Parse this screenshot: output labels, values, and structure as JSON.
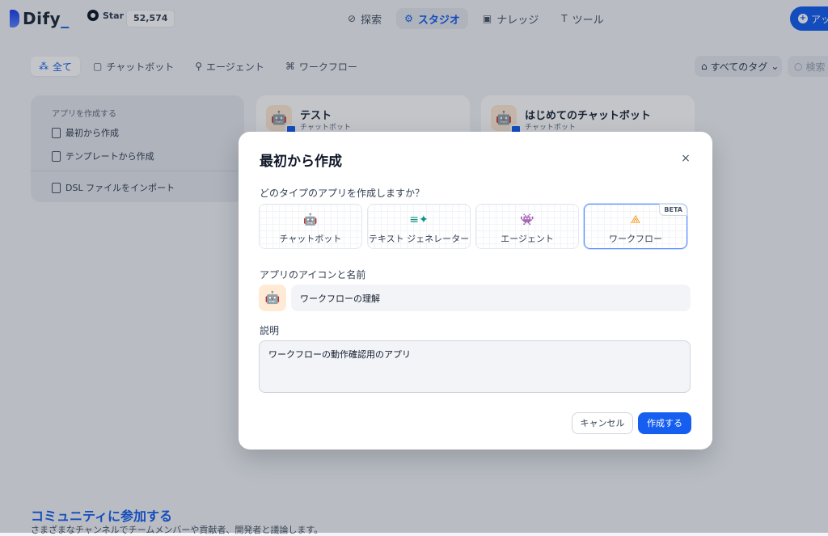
{
  "brand": {
    "name": "Dify",
    "suffix": "_"
  },
  "github": {
    "star_label": "Star",
    "star_count": "52,574"
  },
  "nav": {
    "items": [
      {
        "label": "探索",
        "icon": "compass-icon",
        "glyph": "⊘"
      },
      {
        "label": "スタジオ",
        "icon": "robot-icon",
        "glyph": "⚙"
      },
      {
        "label": "ナレッジ",
        "icon": "book-icon",
        "glyph": "▣"
      },
      {
        "label": "ツール",
        "icon": "hammer-icon",
        "glyph": "T"
      }
    ],
    "active": "スタジオ"
  },
  "account": {
    "label": "アッ"
  },
  "filters": {
    "tabs": [
      {
        "label": "全て",
        "glyph": "⁂"
      },
      {
        "label": "チャットボット",
        "glyph": "▢"
      },
      {
        "label": "エージェント",
        "glyph": "⚲"
      },
      {
        "label": "ワークフロー",
        "glyph": "⌘"
      }
    ],
    "tag_select": "すべてのタグ",
    "search_placeholder": "検索"
  },
  "create_card": {
    "title": "アプリを作成する",
    "blank": "最初から作成",
    "template": "テンプレートから作成",
    "dsl": "DSL ファイルをインポート"
  },
  "apps": [
    {
      "name": "テスト",
      "type": "チャットボット",
      "emoji": "🤖"
    },
    {
      "name": "はじめてのチャットボット",
      "type": "チャットボット",
      "emoji": "🤖"
    }
  ],
  "community": {
    "title": "コミュニティに参加する",
    "subtitle": "さまざまなチャンネルでチームメンバーや貢献者、開発者と議論します。"
  },
  "modal": {
    "title": "最初から作成",
    "close": "×",
    "type_question": "どのタイプのアプリを作成しますか？",
    "types": [
      {
        "label": "チャットボット",
        "icon": "chatbot-icon",
        "glyph": "🤖",
        "color": "#155eef"
      },
      {
        "label": "テキスト ジェネレーター",
        "icon": "text-generator-icon",
        "glyph": "≡✦",
        "color": "#0e9384"
      },
      {
        "label": "エージェント",
        "icon": "agent-icon",
        "glyph": "👾",
        "color": "#444ce7"
      },
      {
        "label": "ワークフロー",
        "icon": "workflow-icon",
        "glyph": "⟁",
        "color": "#f79009"
      }
    ],
    "selected_type": "ワークフロー",
    "beta_badge": "BETA",
    "name_label": "アプリのアイコンと名前",
    "icon_emoji": "🤖",
    "name_value": "ワークフローの理解",
    "desc_label": "説明",
    "desc_value": "ワークフローの動作確認用のアプリ",
    "cancel": "キャンセル",
    "create": "作成する"
  }
}
